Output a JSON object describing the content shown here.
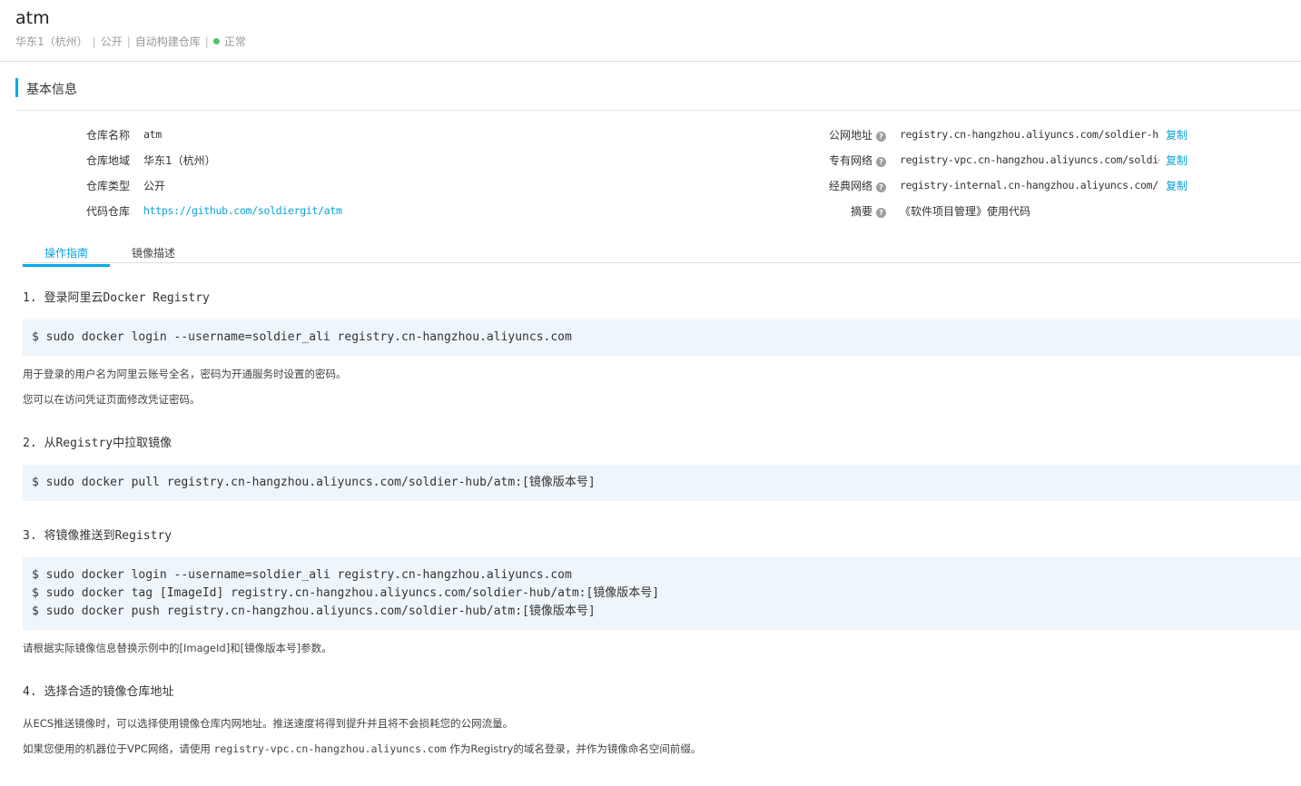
{
  "header": {
    "title": "atm",
    "region": "华东1（杭州）",
    "visibility": "公开",
    "build": "自动构建仓库",
    "status": "正常",
    "status_color": "#4fc46a"
  },
  "basic": {
    "section_title": "基本信息",
    "left": [
      {
        "label": "仓库名称",
        "value": "atm"
      },
      {
        "label": "仓库地域",
        "value": "华东1（杭州）"
      },
      {
        "label": "仓库类型",
        "value": "公开"
      },
      {
        "label": "代码仓库",
        "value": "https://github.com/soldiergit/atm"
      }
    ],
    "right": [
      {
        "label": "公网地址",
        "value": "registry.cn-hangzhou.aliyuncs.com/soldier-hub/atm",
        "action": "复制"
      },
      {
        "label": "专有网络",
        "value": "registry-vpc.cn-hangzhou.aliyuncs.com/soldier-hub/atm",
        "action": "复制"
      },
      {
        "label": "经典网络",
        "value": "registry-internal.cn-hangzhou.aliyuncs.com/soldier-hub/atm",
        "action": "复制"
      },
      {
        "label": "摘要",
        "value": "《软件项目管理》使用代码"
      }
    ],
    "help_glyph": "?"
  },
  "tabs": [
    {
      "label": "操作指南",
      "active": true
    },
    {
      "label": "镜像描述",
      "active": false
    }
  ],
  "guide": {
    "step1": {
      "title": "1. 登录阿里云Docker Registry",
      "code": [
        "$ sudo docker login --username=soldier_ali registry.cn-hangzhou.aliyuncs.com"
      ],
      "notes": [
        "用于登录的用户名为阿里云账号全名，密码为开通服务时设置的密码。",
        "您可以在访问凭证页面修改凭证密码。"
      ]
    },
    "step2": {
      "title": "2. 从Registry中拉取镜像",
      "code": [
        "$ sudo docker pull registry.cn-hangzhou.aliyuncs.com/soldier-hub/atm:[镜像版本号]"
      ]
    },
    "step3": {
      "title": "3. 将镜像推送到Registry",
      "code": [
        "$ sudo docker login --username=soldier_ali registry.cn-hangzhou.aliyuncs.com",
        "$ sudo docker tag [ImageId] registry.cn-hangzhou.aliyuncs.com/soldier-hub/atm:[镜像版本号]",
        "$ sudo docker push registry.cn-hangzhou.aliyuncs.com/soldier-hub/atm:[镜像版本号]"
      ],
      "note": "请根据实际镜像信息替换示例中的[ImageId]和[镜像版本号]参数。"
    },
    "step4": {
      "title": "4. 选择合适的镜像仓库地址",
      "note1": "从ECS推送镜像时，可以选择使用镜像仓库内网地址。推送速度将得到提升并且将不会损耗您的公网流量。",
      "note2_prefix": "如果您使用的机器位于VPC网络，请使用 ",
      "note2_addr": "registry-vpc.cn-hangzhou.aliyuncs.com",
      "note2_suffix": " 作为Registry的域名登录，并作为镜像命名空间前缀。"
    }
  }
}
